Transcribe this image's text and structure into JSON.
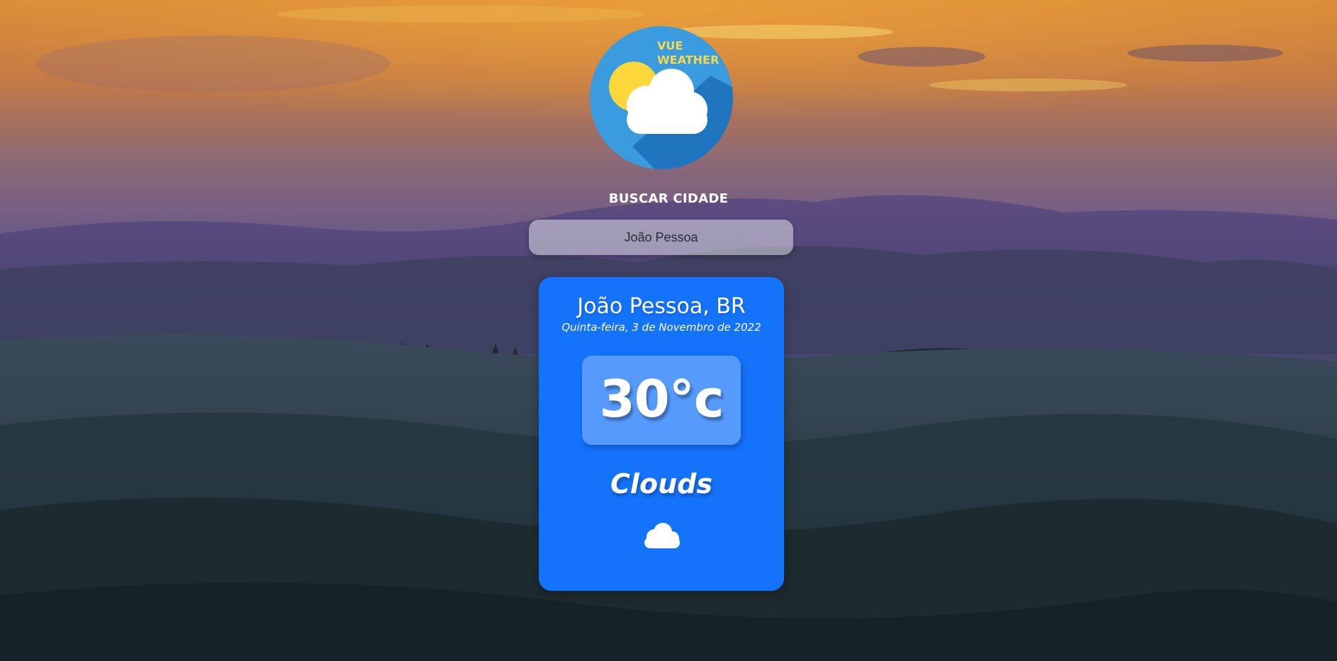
{
  "logo": {
    "line1": "VUE",
    "line2": "WEATHER",
    "icon": "sun-cloud-icon"
  },
  "search": {
    "label": "BUSCAR CIDADE",
    "value": "João Pessoa",
    "placeholder": ""
  },
  "weather": {
    "city": "João Pessoa, BR",
    "date": "Quinta-feira, 3 de Novembro de 2022",
    "temperature": "30°c",
    "condition": "Clouds",
    "condition_icon": "cloud-icon"
  },
  "colors": {
    "card": "#1473fb",
    "logo_circle": "#3a9bde",
    "logo_text": "#f6d84a",
    "sun": "#fcd73a"
  }
}
